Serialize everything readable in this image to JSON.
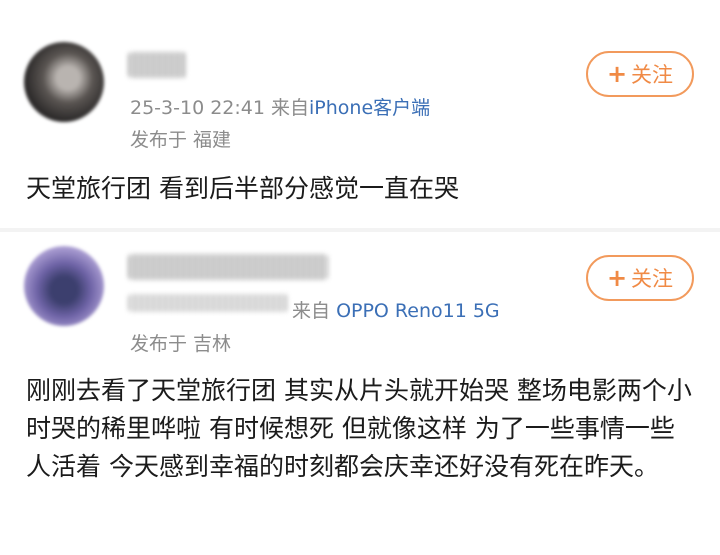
{
  "posts": [
    {
      "timestamp": "25-3-10 22:41",
      "source_prefix": "来自",
      "device": "iPhone客户端",
      "location": "发布于 福建",
      "follow_label": "关注",
      "content": "天堂旅行团 看到后半部分感觉一直在哭"
    },
    {
      "source_prefix": "来自",
      "device": "OPPO Reno11 5G",
      "location": "发布于 吉林",
      "follow_label": "关注",
      "content": "刚刚去看了天堂旅行团 其实从片头就开始哭 整场电影两个小时哭的稀里哗啦 有时候想死 但就像这样 为了一些事情一些人活着 今天感到幸福的时刻都会庆幸还好没有死在昨天。"
    }
  ],
  "colors": {
    "accent": "#f08a45",
    "link": "#3b6fb6",
    "meta": "#8c8c8c"
  }
}
